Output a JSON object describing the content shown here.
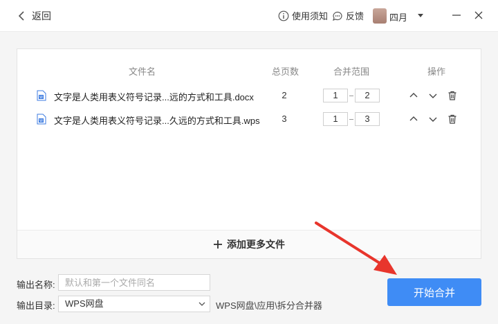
{
  "header": {
    "back_label": "返回",
    "help_label": "使用须知",
    "feedback_label": "反馈",
    "username": "四月"
  },
  "table": {
    "columns": [
      "文件名",
      "总页数",
      "合并范围",
      "操作"
    ],
    "rows": [
      {
        "name": "文字是人类用表义符号记录...远的方式和工具.docx",
        "pages": "2",
        "range_from": "1",
        "range_to": "2"
      },
      {
        "name": "文字是人类用表义符号记录...久远的方式和工具.wps",
        "pages": "3",
        "range_from": "1",
        "range_to": "3"
      }
    ]
  },
  "add_more_label": "添加更多文件",
  "output": {
    "name_label": "输出名称:",
    "name_placeholder": "默认和第一个文件同名",
    "dir_label": "输出目录:",
    "dir_value": "WPS网盘",
    "dir_path": "WPS网盘\\应用\\拆分合并器"
  },
  "start_button_label": "开始合并",
  "colors": {
    "accent": "#3f8cf5",
    "annotation_arrow": "#e8352c"
  }
}
